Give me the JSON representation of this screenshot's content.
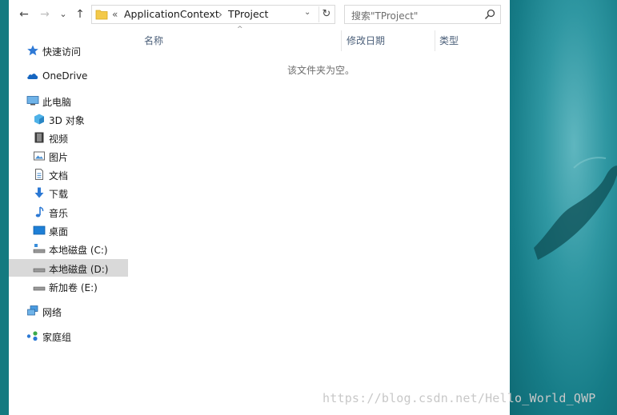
{
  "nav": {
    "back": "←",
    "forward": "→",
    "recent": "⌄",
    "up": "↑"
  },
  "address": {
    "overflow": "«",
    "crumbs": [
      "ApplicationContext",
      "TProject"
    ],
    "separator": "›",
    "dropdown": "⌄",
    "refresh": "↻"
  },
  "search": {
    "placeholder": "搜索\"TProject\""
  },
  "columns": {
    "name": "名称",
    "modified": "修改日期",
    "type": "类型",
    "sort": "^"
  },
  "content": {
    "empty_message": "该文件夹为空。"
  },
  "sidebar": {
    "quick_access": "快速访问",
    "onedrive": "OneDrive",
    "this_pc": "此电脑",
    "objects3d": "3D 对象",
    "videos": "视频",
    "pictures": "图片",
    "documents": "文档",
    "downloads": "下载",
    "music": "音乐",
    "desktop": "桌面",
    "disk_c": "本地磁盘 (C:)",
    "disk_d": "本地磁盘 (D:)",
    "disk_e": "新加卷 (E:)",
    "network": "网络",
    "homegroup": "家庭组"
  },
  "watermark": "https://blog.csdn.net/Hello_World_QWP",
  "colors": {
    "accent": "#0078d7",
    "selected": "#d9d9d9",
    "desktop_bg": "#1f8a95"
  }
}
